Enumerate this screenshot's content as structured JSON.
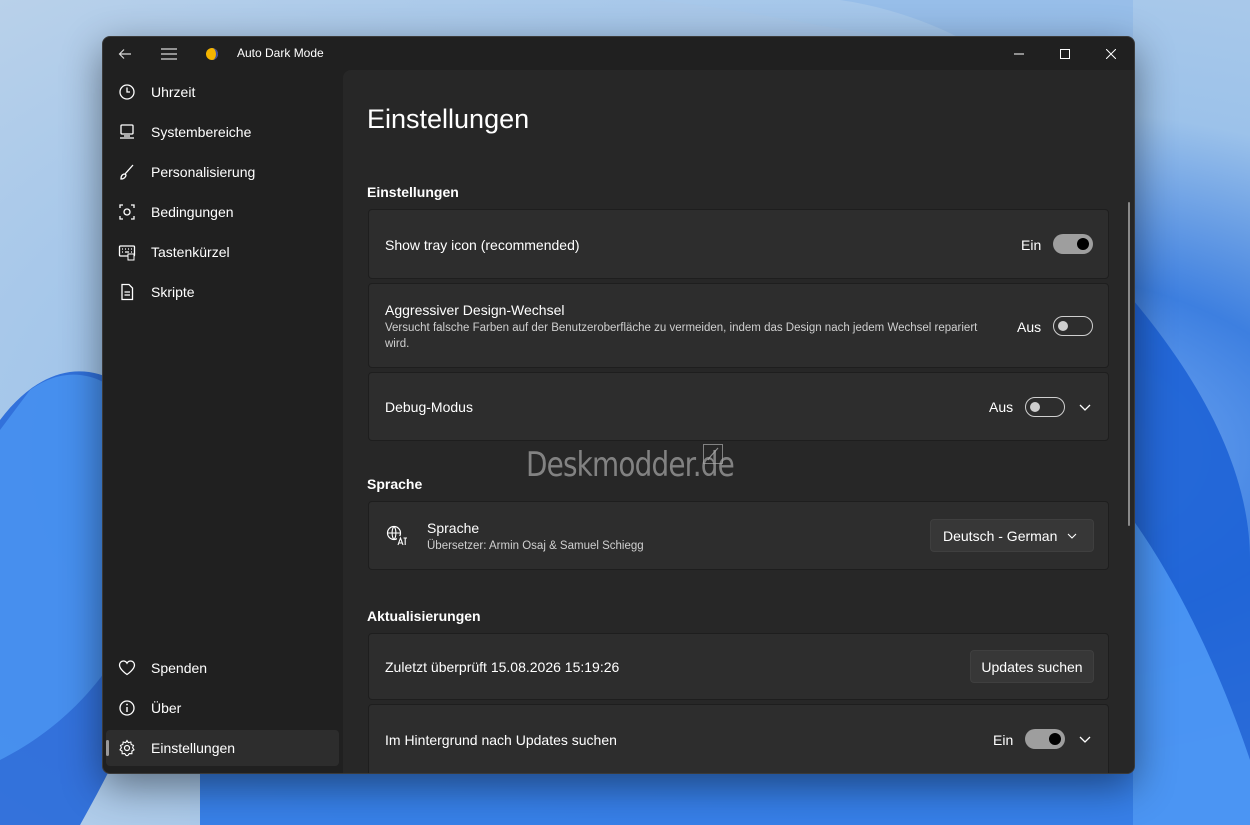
{
  "app": {
    "title": "Auto Dark Mode"
  },
  "titlebar": {
    "back_icon": "back-arrow-icon",
    "menu_icon": "hamburger-icon",
    "minimize": "minimize-icon",
    "maximize": "maximize-icon",
    "close": "close-icon"
  },
  "sidebar": {
    "items": [
      {
        "label": "Uhrzeit",
        "icon": "clock-icon"
      },
      {
        "label": "Systembereiche",
        "icon": "monitor-icon"
      },
      {
        "label": "Personalisierung",
        "icon": "brush-icon"
      },
      {
        "label": "Bedingungen",
        "icon": "conditions-icon"
      },
      {
        "label": "Tastenkürzel",
        "icon": "keyboard-icon"
      },
      {
        "label": "Skripte",
        "icon": "script-icon"
      }
    ],
    "footer": [
      {
        "label": "Spenden",
        "icon": "heart-icon"
      },
      {
        "label": "Über",
        "icon": "info-icon"
      },
      {
        "label": "Einstellungen",
        "icon": "gear-icon",
        "selected": true
      }
    ]
  },
  "main": {
    "title": "Einstellungen",
    "sections": {
      "settings": "Einstellungen",
      "language": "Sprache",
      "updates": "Aktualisierungen"
    },
    "cards": {
      "tray": {
        "title": "Show tray icon (recommended)",
        "state": "Ein",
        "on": true
      },
      "aggressive": {
        "title": "Aggressiver Design-Wechsel",
        "desc": "Versucht falsche Farben auf der Benutzeroberfläche zu vermeiden, indem das Design nach jedem Wechsel repariert wird.",
        "state": "Aus",
        "on": false
      },
      "debug": {
        "title": "Debug-Modus",
        "state": "Aus",
        "on": false
      },
      "language": {
        "title": "Sprache",
        "desc": "Übersetzer: Armin Osaj & Samuel Schiegg",
        "selected": "Deutsch - German",
        "icon": "language-icon"
      },
      "last_checked": {
        "title": "Zuletzt überprüft 15.08.2026 15:19:26",
        "button": "Updates suchen"
      },
      "background_updates": {
        "title": "Im Hintergrund nach Updates suchen",
        "state": "Ein",
        "on": true
      }
    }
  },
  "watermark": {
    "text": "Deskmodder.de"
  }
}
